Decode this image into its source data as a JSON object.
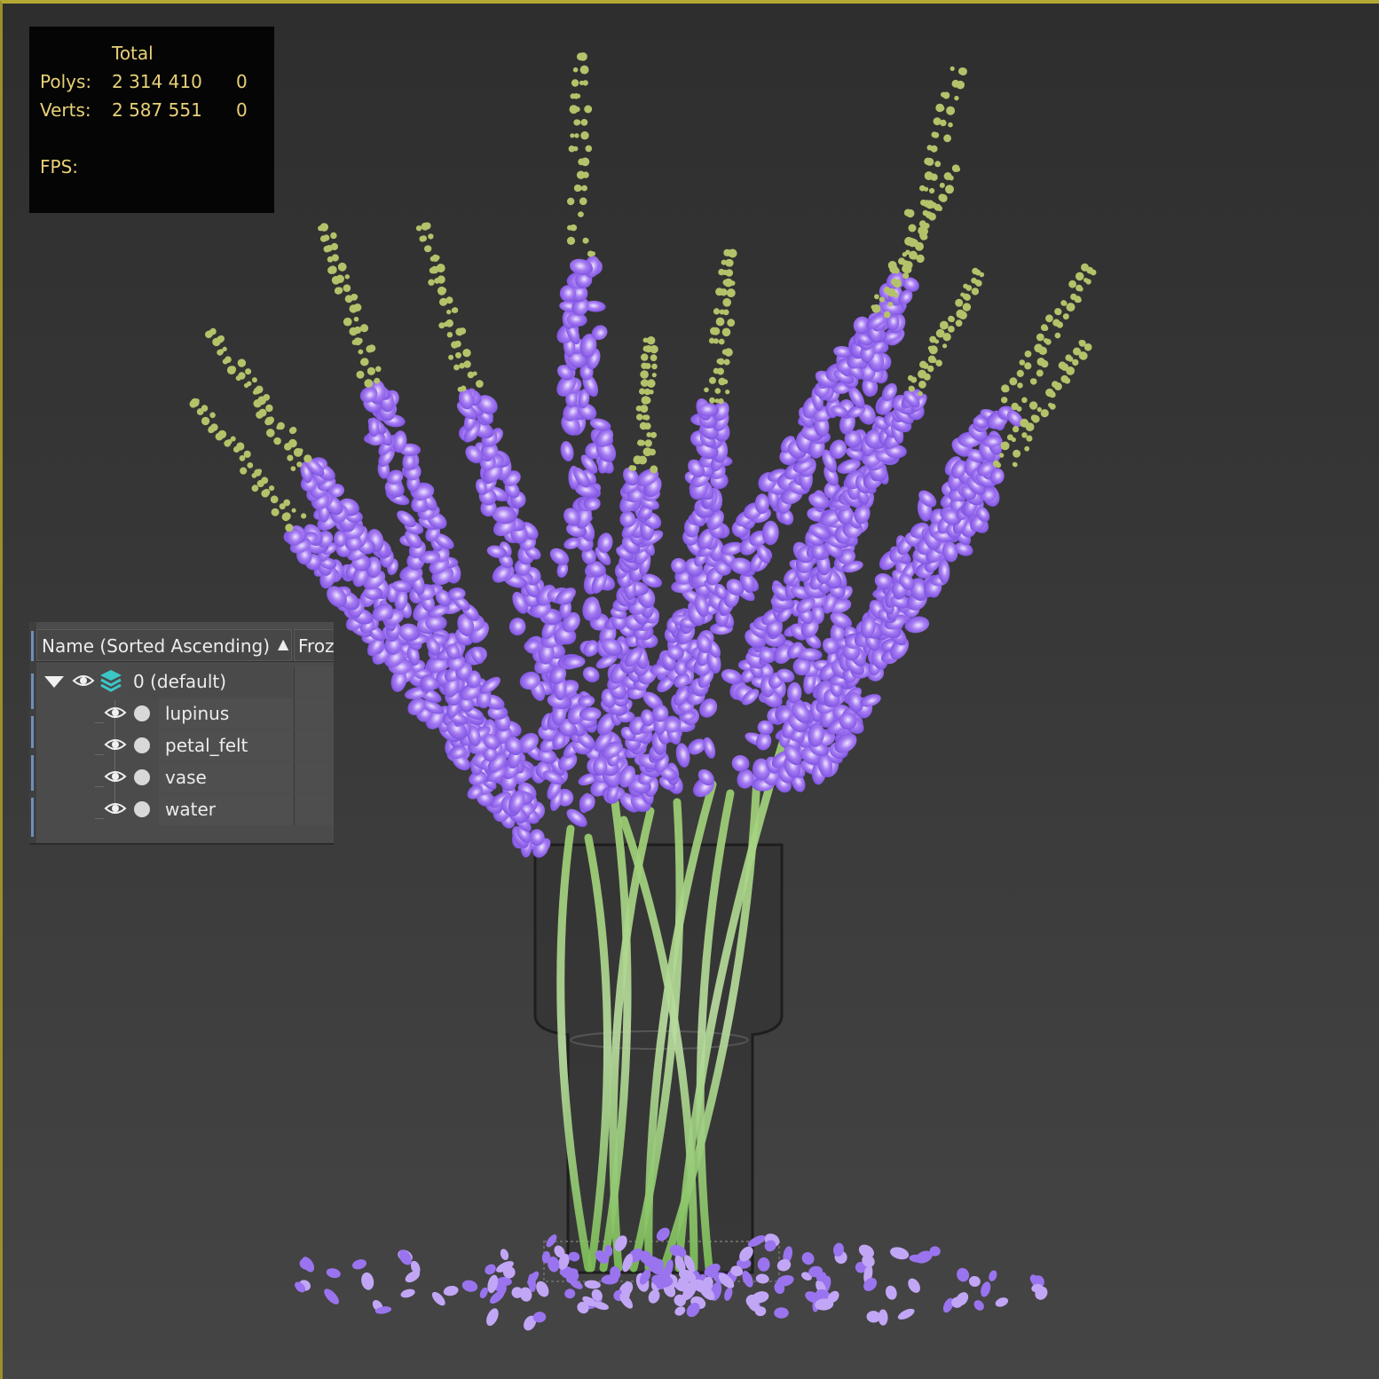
{
  "stats": {
    "total_label": "Total",
    "polys_label": "Polys:",
    "polys_total": "2 314 410",
    "polys_selected": "0",
    "verts_label": "Verts:",
    "verts_total": "2 587 551",
    "verts_selected": "0",
    "fps_label": "FPS:"
  },
  "layer_explorer": {
    "header": {
      "name_column": "Name (Sorted Ascending)",
      "sort_icon": "sort-ascending-arrow",
      "frozen_column": "Froz"
    },
    "root_layer": {
      "label": "0 (default)",
      "expanded": true,
      "visible": true,
      "icon": "layers-icon"
    },
    "objects": [
      {
        "label": "lupinus",
        "visible": true
      },
      {
        "label": "petal_felt",
        "visible": true
      },
      {
        "label": "vase",
        "visible": true
      },
      {
        "label": "water",
        "visible": true
      }
    ]
  },
  "colors": {
    "viewport_border": "#b5a733",
    "stats_text": "#e8d178",
    "flower_purple": "#8a5fe6",
    "flower_tip_green": "#b4c26a",
    "stem_green": "#8cc36a",
    "layer_icon_teal": "#3cc6c6"
  }
}
